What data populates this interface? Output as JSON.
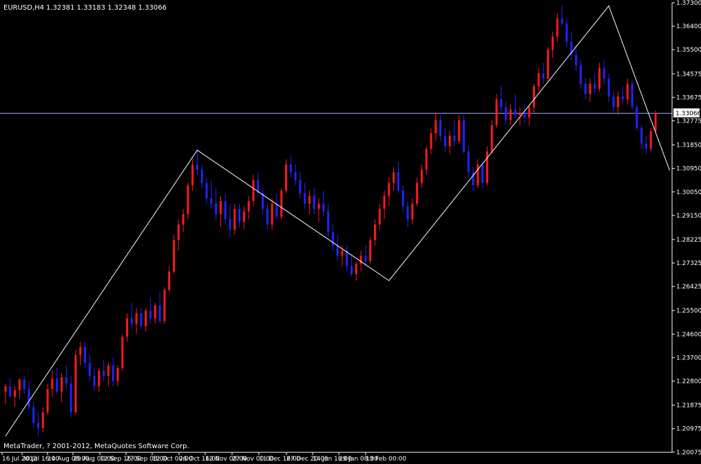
{
  "header": {
    "symbol_timeframe": "EURUSD,H4",
    "quote_values": "1.32381 1.33183 1.32348 1.33066"
  },
  "footer": {
    "copyright": "MetaTrader, ? 2001-2012, MetaQuotes Software Corp."
  },
  "colors": {
    "background": "#000000",
    "bull_candle": "#ff1a1a",
    "bear_candle": "#2323ff",
    "zigzag": "#ffffff",
    "current_price_line": "#9aa3ff",
    "axis": "#ffffff",
    "price_tag_bg": "#ffffff",
    "price_tag_text": "#000000"
  },
  "chart_data": {
    "type": "candlestick",
    "title": "",
    "xlabel": "",
    "ylabel": "",
    "ylim": [
      1.2007,
      1.373
    ],
    "x_tick_labels": [
      "16 Jul 2012",
      "30 Jul 16:00",
      "14 Aug 08:00",
      "29 Aug 00:00",
      "12 Sep 16:00",
      "27 Sep 08:00",
      "12 Oct 00:00",
      "26 Oct 16:00",
      "12 Nov 08:00",
      "27 Nov 00:00",
      "11 Dec 16:00",
      "27 Dec 20:00",
      "14 Jan 16:00",
      "29 Jan 08:00",
      "13 Feb 00:00"
    ],
    "y_tick_labels": [
      "1.37300",
      "1.36400",
      "1.35500",
      "1.34575",
      "1.33675",
      "1.32775",
      "1.31850",
      "1.30950",
      "1.30050",
      "1.29150",
      "1.28225",
      "1.27325",
      "1.26425",
      "1.25500",
      "1.24600",
      "1.23700",
      "1.22800",
      "1.21875",
      "1.20975",
      "1.20075"
    ],
    "current_price": 1.33066,
    "zigzag_path": [
      {
        "x": 0,
        "y": 1.2069
      },
      {
        "x": 41,
        "y": 1.3165
      },
      {
        "x": 82,
        "y": 1.2665
      },
      {
        "x": 129,
        "y": 1.3718
      },
      {
        "x": 142,
        "y": 1.3088
      }
    ],
    "candles": [
      {
        "t": 0,
        "o": 1.224,
        "h": 1.227,
        "l": 1.219,
        "c": 1.226
      },
      {
        "t": 1,
        "o": 1.226,
        "h": 1.229,
        "l": 1.222,
        "c": 1.222
      },
      {
        "t": 2,
        "o": 1.222,
        "h": 1.226,
        "l": 1.218,
        "c": 1.2245
      },
      {
        "t": 3,
        "o": 1.2245,
        "h": 1.229,
        "l": 1.221,
        "c": 1.2285
      },
      {
        "t": 4,
        "o": 1.2285,
        "h": 1.23,
        "l": 1.223,
        "c": 1.225
      },
      {
        "t": 5,
        "o": 1.225,
        "h": 1.228,
        "l": 1.217,
        "c": 1.218
      },
      {
        "t": 6,
        "o": 1.218,
        "h": 1.22,
        "l": 1.21,
        "c": 1.212
      },
      {
        "t": 7,
        "o": 1.212,
        "h": 1.216,
        "l": 1.2069,
        "c": 1.21
      },
      {
        "t": 8,
        "o": 1.21,
        "h": 1.218,
        "l": 1.2085,
        "c": 1.216
      },
      {
        "t": 9,
        "o": 1.216,
        "h": 1.227,
        "l": 1.215,
        "c": 1.225
      },
      {
        "t": 10,
        "o": 1.225,
        "h": 1.232,
        "l": 1.222,
        "c": 1.229
      },
      {
        "t": 11,
        "o": 1.229,
        "h": 1.233,
        "l": 1.223,
        "c": 1.224
      },
      {
        "t": 12,
        "o": 1.224,
        "h": 1.231,
        "l": 1.22,
        "c": 1.2295
      },
      {
        "t": 13,
        "o": 1.2295,
        "h": 1.234,
        "l": 1.225,
        "c": 1.227
      },
      {
        "t": 14,
        "o": 1.227,
        "h": 1.23,
        "l": 1.214,
        "c": 1.216
      },
      {
        "t": 15,
        "o": 1.216,
        "h": 1.24,
        "l": 1.215,
        "c": 1.238
      },
      {
        "t": 16,
        "o": 1.238,
        "h": 1.243,
        "l": 1.234,
        "c": 1.241
      },
      {
        "t": 17,
        "o": 1.241,
        "h": 1.243,
        "l": 1.233,
        "c": 1.235
      },
      {
        "t": 18,
        "o": 1.235,
        "h": 1.238,
        "l": 1.228,
        "c": 1.23
      },
      {
        "t": 19,
        "o": 1.23,
        "h": 1.233,
        "l": 1.224,
        "c": 1.226
      },
      {
        "t": 20,
        "o": 1.226,
        "h": 1.233,
        "l": 1.224,
        "c": 1.232
      },
      {
        "t": 21,
        "o": 1.232,
        "h": 1.236,
        "l": 1.228,
        "c": 1.23
      },
      {
        "t": 22,
        "o": 1.23,
        "h": 1.235,
        "l": 1.226,
        "c": 1.234
      },
      {
        "t": 23,
        "o": 1.234,
        "h": 1.237,
        "l": 1.226,
        "c": 1.228
      },
      {
        "t": 24,
        "o": 1.228,
        "h": 1.234,
        "l": 1.226,
        "c": 1.233
      },
      {
        "t": 25,
        "o": 1.233,
        "h": 1.246,
        "l": 1.232,
        "c": 1.245
      },
      {
        "t": 26,
        "o": 1.245,
        "h": 1.254,
        "l": 1.243,
        "c": 1.252
      },
      {
        "t": 27,
        "o": 1.252,
        "h": 1.258,
        "l": 1.248,
        "c": 1.25
      },
      {
        "t": 28,
        "o": 1.25,
        "h": 1.256,
        "l": 1.246,
        "c": 1.254
      },
      {
        "t": 29,
        "o": 1.254,
        "h": 1.256,
        "l": 1.248,
        "c": 1.249
      },
      {
        "t": 30,
        "o": 1.249,
        "h": 1.256,
        "l": 1.247,
        "c": 1.255
      },
      {
        "t": 31,
        "o": 1.255,
        "h": 1.26,
        "l": 1.25,
        "c": 1.252
      },
      {
        "t": 32,
        "o": 1.252,
        "h": 1.258,
        "l": 1.25,
        "c": 1.257
      },
      {
        "t": 33,
        "o": 1.257,
        "h": 1.262,
        "l": 1.25,
        "c": 1.251
      },
      {
        "t": 34,
        "o": 1.251,
        "h": 1.264,
        "l": 1.25,
        "c": 1.263
      },
      {
        "t": 35,
        "o": 1.263,
        "h": 1.272,
        "l": 1.262,
        "c": 1.27
      },
      {
        "t": 36,
        "o": 1.27,
        "h": 1.284,
        "l": 1.269,
        "c": 1.282
      },
      {
        "t": 37,
        "o": 1.282,
        "h": 1.29,
        "l": 1.278,
        "c": 1.288
      },
      {
        "t": 38,
        "o": 1.288,
        "h": 1.294,
        "l": 1.285,
        "c": 1.292
      },
      {
        "t": 39,
        "o": 1.292,
        "h": 1.304,
        "l": 1.29,
        "c": 1.303
      },
      {
        "t": 40,
        "o": 1.303,
        "h": 1.313,
        "l": 1.301,
        "c": 1.311
      },
      {
        "t": 41,
        "o": 1.311,
        "h": 1.3168,
        "l": 1.307,
        "c": 1.309
      },
      {
        "t": 42,
        "o": 1.309,
        "h": 1.311,
        "l": 1.302,
        "c": 1.304
      },
      {
        "t": 43,
        "o": 1.304,
        "h": 1.306,
        "l": 1.296,
        "c": 1.298
      },
      {
        "t": 44,
        "o": 1.298,
        "h": 1.305,
        "l": 1.294,
        "c": 1.296
      },
      {
        "t": 45,
        "o": 1.296,
        "h": 1.302,
        "l": 1.29,
        "c": 1.292
      },
      {
        "t": 46,
        "o": 1.292,
        "h": 1.299,
        "l": 1.287,
        "c": 1.297
      },
      {
        "t": 47,
        "o": 1.297,
        "h": 1.3,
        "l": 1.288,
        "c": 1.29
      },
      {
        "t": 48,
        "o": 1.29,
        "h": 1.296,
        "l": 1.283,
        "c": 1.286
      },
      {
        "t": 49,
        "o": 1.286,
        "h": 1.296,
        "l": 1.284,
        "c": 1.294
      },
      {
        "t": 50,
        "o": 1.294,
        "h": 1.296,
        "l": 1.287,
        "c": 1.289
      },
      {
        "t": 51,
        "o": 1.289,
        "h": 1.295,
        "l": 1.286,
        "c": 1.293
      },
      {
        "t": 52,
        "o": 1.293,
        "h": 1.299,
        "l": 1.29,
        "c": 1.297
      },
      {
        "t": 53,
        "o": 1.297,
        "h": 1.307,
        "l": 1.295,
        "c": 1.305
      },
      {
        "t": 54,
        "o": 1.305,
        "h": 1.308,
        "l": 1.299,
        "c": 1.3
      },
      {
        "t": 55,
        "o": 1.3,
        "h": 1.302,
        "l": 1.292,
        "c": 1.294
      },
      {
        "t": 56,
        "o": 1.294,
        "h": 1.296,
        "l": 1.286,
        "c": 1.288
      },
      {
        "t": 57,
        "o": 1.288,
        "h": 1.298,
        "l": 1.286,
        "c": 1.296
      },
      {
        "t": 58,
        "o": 1.296,
        "h": 1.3,
        "l": 1.29,
        "c": 1.291
      },
      {
        "t": 59,
        "o": 1.291,
        "h": 1.302,
        "l": 1.29,
        "c": 1.301
      },
      {
        "t": 60,
        "o": 1.301,
        "h": 1.313,
        "l": 1.3,
        "c": 1.311
      },
      {
        "t": 61,
        "o": 1.311,
        "h": 1.314,
        "l": 1.306,
        "c": 1.308
      },
      {
        "t": 62,
        "o": 1.308,
        "h": 1.311,
        "l": 1.303,
        "c": 1.305
      },
      {
        "t": 63,
        "o": 1.305,
        "h": 1.308,
        "l": 1.298,
        "c": 1.3
      },
      {
        "t": 64,
        "o": 1.3,
        "h": 1.304,
        "l": 1.294,
        "c": 1.296
      },
      {
        "t": 65,
        "o": 1.296,
        "h": 1.301,
        "l": 1.292,
        "c": 1.299
      },
      {
        "t": 66,
        "o": 1.299,
        "h": 1.302,
        "l": 1.292,
        "c": 1.294
      },
      {
        "t": 67,
        "o": 1.294,
        "h": 1.298,
        "l": 1.289,
        "c": 1.296
      },
      {
        "t": 68,
        "o": 1.296,
        "h": 1.301,
        "l": 1.291,
        "c": 1.293
      },
      {
        "t": 69,
        "o": 1.293,
        "h": 1.296,
        "l": 1.283,
        "c": 1.285
      },
      {
        "t": 70,
        "o": 1.285,
        "h": 1.288,
        "l": 1.278,
        "c": 1.28
      },
      {
        "t": 71,
        "o": 1.28,
        "h": 1.284,
        "l": 1.274,
        "c": 1.276
      },
      {
        "t": 72,
        "o": 1.276,
        "h": 1.28,
        "l": 1.272,
        "c": 1.278
      },
      {
        "t": 73,
        "o": 1.278,
        "h": 1.28,
        "l": 1.27,
        "c": 1.272
      },
      {
        "t": 74,
        "o": 1.272,
        "h": 1.276,
        "l": 1.268,
        "c": 1.269
      },
      {
        "t": 75,
        "o": 1.269,
        "h": 1.274,
        "l": 1.2665,
        "c": 1.273
      },
      {
        "t": 76,
        "o": 1.273,
        "h": 1.278,
        "l": 1.27,
        "c": 1.276
      },
      {
        "t": 77,
        "o": 1.276,
        "h": 1.28,
        "l": 1.272,
        "c": 1.274
      },
      {
        "t": 78,
        "o": 1.274,
        "h": 1.283,
        "l": 1.273,
        "c": 1.282
      },
      {
        "t": 79,
        "o": 1.282,
        "h": 1.29,
        "l": 1.28,
        "c": 1.288
      },
      {
        "t": 80,
        "o": 1.288,
        "h": 1.296,
        "l": 1.286,
        "c": 1.294
      },
      {
        "t": 81,
        "o": 1.294,
        "h": 1.301,
        "l": 1.29,
        "c": 1.299
      },
      {
        "t": 82,
        "o": 1.299,
        "h": 1.306,
        "l": 1.295,
        "c": 1.304
      },
      {
        "t": 83,
        "o": 1.304,
        "h": 1.31,
        "l": 1.301,
        "c": 1.308
      },
      {
        "t": 84,
        "o": 1.308,
        "h": 1.312,
        "l": 1.3,
        "c": 1.301
      },
      {
        "t": 85,
        "o": 1.301,
        "h": 1.303,
        "l": 1.293,
        "c": 1.295
      },
      {
        "t": 86,
        "o": 1.295,
        "h": 1.297,
        "l": 1.287,
        "c": 1.29
      },
      {
        "t": 87,
        "o": 1.29,
        "h": 1.298,
        "l": 1.288,
        "c": 1.296
      },
      {
        "t": 88,
        "o": 1.296,
        "h": 1.306,
        "l": 1.295,
        "c": 1.304
      },
      {
        "t": 89,
        "o": 1.304,
        "h": 1.311,
        "l": 1.302,
        "c": 1.309
      },
      {
        "t": 90,
        "o": 1.309,
        "h": 1.318,
        "l": 1.307,
        "c": 1.317
      },
      {
        "t": 91,
        "o": 1.317,
        "h": 1.325,
        "l": 1.315,
        "c": 1.323
      },
      {
        "t": 92,
        "o": 1.323,
        "h": 1.331,
        "l": 1.32,
        "c": 1.328
      },
      {
        "t": 93,
        "o": 1.328,
        "h": 1.33,
        "l": 1.32,
        "c": 1.322
      },
      {
        "t": 94,
        "o": 1.322,
        "h": 1.325,
        "l": 1.316,
        "c": 1.318
      },
      {
        "t": 95,
        "o": 1.318,
        "h": 1.324,
        "l": 1.315,
        "c": 1.322
      },
      {
        "t": 96,
        "o": 1.322,
        "h": 1.328,
        "l": 1.318,
        "c": 1.32
      },
      {
        "t": 97,
        "o": 1.32,
        "h": 1.33,
        "l": 1.319,
        "c": 1.328
      },
      {
        "t": 98,
        "o": 1.328,
        "h": 1.33,
        "l": 1.315,
        "c": 1.316
      },
      {
        "t": 99,
        "o": 1.316,
        "h": 1.318,
        "l": 1.306,
        "c": 1.308
      },
      {
        "t": 100,
        "o": 1.308,
        "h": 1.31,
        "l": 1.301,
        "c": 1.303
      },
      {
        "t": 101,
        "o": 1.303,
        "h": 1.313,
        "l": 1.302,
        "c": 1.311
      },
      {
        "t": 102,
        "o": 1.311,
        "h": 1.312,
        "l": 1.302,
        "c": 1.304
      },
      {
        "t": 103,
        "o": 1.304,
        "h": 1.318,
        "l": 1.303,
        "c": 1.316
      },
      {
        "t": 104,
        "o": 1.316,
        "h": 1.328,
        "l": 1.315,
        "c": 1.326
      },
      {
        "t": 105,
        "o": 1.326,
        "h": 1.338,
        "l": 1.325,
        "c": 1.336
      },
      {
        "t": 106,
        "o": 1.336,
        "h": 1.341,
        "l": 1.331,
        "c": 1.333
      },
      {
        "t": 107,
        "o": 1.333,
        "h": 1.335,
        "l": 1.326,
        "c": 1.328
      },
      {
        "t": 108,
        "o": 1.328,
        "h": 1.334,
        "l": 1.326,
        "c": 1.332
      },
      {
        "t": 109,
        "o": 1.332,
        "h": 1.338,
        "l": 1.329,
        "c": 1.33
      },
      {
        "t": 110,
        "o": 1.33,
        "h": 1.333,
        "l": 1.326,
        "c": 1.331
      },
      {
        "t": 111,
        "o": 1.331,
        "h": 1.334,
        "l": 1.327,
        "c": 1.329
      },
      {
        "t": 112,
        "o": 1.329,
        "h": 1.334,
        "l": 1.326,
        "c": 1.333
      },
      {
        "t": 113,
        "o": 1.333,
        "h": 1.342,
        "l": 1.331,
        "c": 1.341
      },
      {
        "t": 114,
        "o": 1.341,
        "h": 1.348,
        "l": 1.339,
        "c": 1.346
      },
      {
        "t": 115,
        "o": 1.346,
        "h": 1.35,
        "l": 1.342,
        "c": 1.344
      },
      {
        "t": 116,
        "o": 1.344,
        "h": 1.356,
        "l": 1.343,
        "c": 1.355
      },
      {
        "t": 117,
        "o": 1.355,
        "h": 1.362,
        "l": 1.352,
        "c": 1.36
      },
      {
        "t": 118,
        "o": 1.36,
        "h": 1.369,
        "l": 1.358,
        "c": 1.367
      },
      {
        "t": 119,
        "o": 1.367,
        "h": 1.3718,
        "l": 1.364,
        "c": 1.365
      },
      {
        "t": 120,
        "o": 1.365,
        "h": 1.367,
        "l": 1.356,
        "c": 1.358
      },
      {
        "t": 121,
        "o": 1.358,
        "h": 1.362,
        "l": 1.351,
        "c": 1.353
      },
      {
        "t": 122,
        "o": 1.353,
        "h": 1.357,
        "l": 1.347,
        "c": 1.349
      },
      {
        "t": 123,
        "o": 1.349,
        "h": 1.351,
        "l": 1.34,
        "c": 1.342
      },
      {
        "t": 124,
        "o": 1.342,
        "h": 1.344,
        "l": 1.336,
        "c": 1.338
      },
      {
        "t": 125,
        "o": 1.338,
        "h": 1.344,
        "l": 1.335,
        "c": 1.342
      },
      {
        "t": 126,
        "o": 1.342,
        "h": 1.346,
        "l": 1.338,
        "c": 1.34
      },
      {
        "t": 127,
        "o": 1.34,
        "h": 1.35,
        "l": 1.339,
        "c": 1.348
      },
      {
        "t": 128,
        "o": 1.348,
        "h": 1.351,
        "l": 1.342,
        "c": 1.344
      },
      {
        "t": 129,
        "o": 1.344,
        "h": 1.346,
        "l": 1.335,
        "c": 1.337
      },
      {
        "t": 130,
        "o": 1.337,
        "h": 1.339,
        "l": 1.331,
        "c": 1.333
      },
      {
        "t": 131,
        "o": 1.333,
        "h": 1.339,
        "l": 1.33,
        "c": 1.337
      },
      {
        "t": 132,
        "o": 1.337,
        "h": 1.341,
        "l": 1.334,
        "c": 1.336
      },
      {
        "t": 133,
        "o": 1.336,
        "h": 1.344,
        "l": 1.334,
        "c": 1.342
      },
      {
        "t": 134,
        "o": 1.342,
        "h": 1.343,
        "l": 1.332,
        "c": 1.333
      },
      {
        "t": 135,
        "o": 1.333,
        "h": 1.334,
        "l": 1.324,
        "c": 1.325
      },
      {
        "t": 136,
        "o": 1.325,
        "h": 1.326,
        "l": 1.317,
        "c": 1.319
      },
      {
        "t": 137,
        "o": 1.319,
        "h": 1.322,
        "l": 1.315,
        "c": 1.317
      },
      {
        "t": 138,
        "o": 1.317,
        "h": 1.325,
        "l": 1.316,
        "c": 1.3238
      },
      {
        "t": 139,
        "o": 1.3238,
        "h": 1.3318,
        "l": 1.3235,
        "c": 1.3307
      }
    ]
  }
}
